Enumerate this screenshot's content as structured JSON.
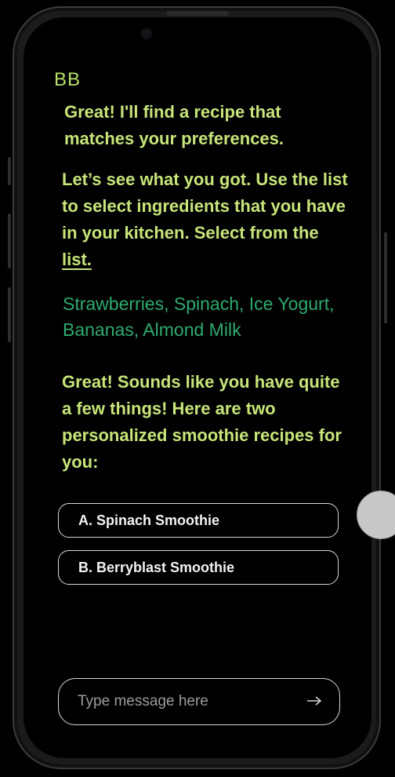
{
  "app": {
    "brand": "BB"
  },
  "messages": {
    "bot_1": "Great! I'll find a recipe that matches your preferences.",
    "bot_2_text": "Let’s see what you got. Use the list to select ingredients that you have in your kitchen. Select from the ",
    "bot_2_link": "list.",
    "user_1": "Strawberries, Spinach, Ice Yogurt, Bananas, Almond Milk",
    "bot_3": "Great! Sounds like you have quite a few things! Here are two personalized smoothie recipes for you:"
  },
  "options": [
    {
      "label": "A. Spinach Smoothie"
    },
    {
      "label": "B. Berryblast Smoothie"
    }
  ],
  "composer": {
    "placeholder": "Type message here",
    "value": ""
  },
  "icons": {
    "send": "arrow-right-icon"
  },
  "colors": {
    "bot_text": "#c7e57a",
    "user_text": "#2faa6e",
    "brand": "#b6e06a",
    "background": "#000000",
    "border": "#d8d8d8"
  }
}
